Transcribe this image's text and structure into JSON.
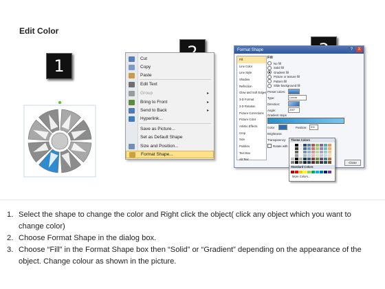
{
  "slide": {
    "title": "Edit Color"
  },
  "step_badges": [
    "1",
    "2",
    "3"
  ],
  "context_menu": {
    "items": [
      {
        "label": "Cut",
        "icon": "scissors-icon",
        "color": "#5b7fb5"
      },
      {
        "label": "Copy",
        "icon": "copy-icon",
        "color": "#7d9ac9"
      },
      {
        "label": "Paste",
        "icon": "paste-icon",
        "color": "#c99b4a"
      },
      {
        "label": "Edit Text",
        "icon": "edit-text-icon",
        "color": "#6f6f6f"
      },
      {
        "label": "Group",
        "icon": "group-icon",
        "color": "#9a9a9a",
        "disabled": true,
        "submenu": true
      },
      {
        "label": "Bring to Front",
        "icon": "bring-front-icon",
        "color": "#5d8a3c",
        "submenu": true
      },
      {
        "label": "Send to Back",
        "icon": "send-back-icon",
        "color": "#4f7ab3",
        "submenu": true
      },
      {
        "label": "Hyperlink...",
        "icon": "hyperlink-icon",
        "color": "#3f7dc2"
      },
      {
        "label": "Save as Picture...",
        "icon": "",
        "color": ""
      },
      {
        "label": "Set as Default Shape",
        "icon": "",
        "color": ""
      },
      {
        "label": "Size and Position...",
        "icon": "size-icon",
        "color": "#6f8fb8"
      },
      {
        "label": "Format Shape...",
        "icon": "format-shape-icon",
        "color": "#c8a23e",
        "highlighted": true
      }
    ]
  },
  "dialog": {
    "title": "Format Shape",
    "title_buttons": [
      "?",
      "X"
    ],
    "categories": [
      "Fill",
      "Line Color",
      "Line Style",
      "Shadow",
      "Reflection",
      "Glow and Soft Edges",
      "3-D Format",
      "3-D Rotation",
      "Picture Corrections",
      "Picture Color",
      "Artistic Effects",
      "Crop",
      "Size",
      "Position",
      "Text Box",
      "Alt Text"
    ],
    "section_title": "Fill",
    "fill_options": [
      {
        "label": "No fill",
        "on": false
      },
      {
        "label": "Solid fill",
        "on": false
      },
      {
        "label": "Gradient fill",
        "on": true
      },
      {
        "label": "Picture or texture fill",
        "on": false
      },
      {
        "label": "Pattern fill",
        "on": false
      },
      {
        "label": "Slide background fill",
        "on": false
      }
    ],
    "preset_colors_label": "Preset colors:",
    "type_label": "Type:",
    "type_value": "Linear",
    "direction_label": "Direction:",
    "angle_label": "Angle:",
    "angle_value": "290°",
    "gradient_stops_label": "Gradient stops",
    "color_label": "Color",
    "position_label": "Position:",
    "position_value": "0%",
    "brightness_label": "Brightness:",
    "transparency_label": "Transparency:",
    "rotate_label": "Rotate with shape",
    "close_label": "Close"
  },
  "palette": {
    "theme_label": "Theme Colors",
    "standard_label": "Standard Colors",
    "more_label": "More Colors...",
    "theme_colors": [
      "#ffffff",
      "#000000",
      "#eeece1",
      "#1f497d",
      "#4f81bd",
      "#c0504d",
      "#9bbb59",
      "#8064a2",
      "#4bacc6",
      "#f79646"
    ],
    "standard_colors": [
      "#c00000",
      "#ff0000",
      "#ffc000",
      "#ffff00",
      "#92d050",
      "#00b050",
      "#00b0f0",
      "#0070c0",
      "#002060",
      "#7030a0"
    ]
  },
  "colors": {
    "wheel_gray": "#9a9a9a",
    "wheel_highlight": "#2f8bd0",
    "selection_handle": "#66bb44"
  },
  "instructions": [
    {
      "n": "1.",
      "text": "Select the shape to change the color and Right click the object( click any object which you want to change color)"
    },
    {
      "n": "2.",
      "text": "Choose Format Shape in the dialog box."
    },
    {
      "n": "3.",
      "text": "Choose “Fill” in the Format Shape box then “Solid” or “Gradient” depending on the appearance of the object. Change colour as shown in the picture."
    }
  ]
}
